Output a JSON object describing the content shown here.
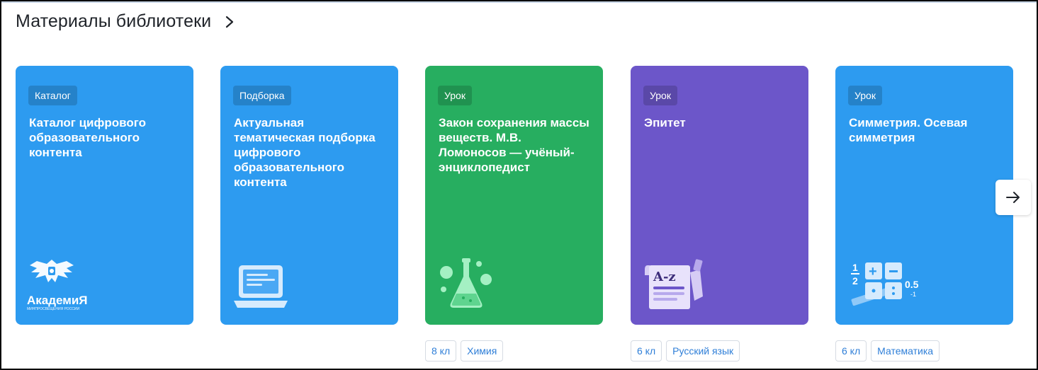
{
  "section": {
    "title": "Материалы библиотеки"
  },
  "cards": [
    {
      "badge": "Каталог",
      "title": "Каталог цифрового образовательного контента",
      "color": "#2d9bf0",
      "logo_text": "АкадемиЯ",
      "logo_sub": "МИНПРОСВЕЩЕНИЯ РОССИИ"
    },
    {
      "badge": "Подборка",
      "title": "Актуальная тематическая подборка цифрового образовательного контента",
      "color": "#2d9bf0"
    },
    {
      "badge": "Урок",
      "title": "Закон сохранения массы веществ. М.В. Ломоносов — учёный-энциклопедист",
      "color": "#27ae60",
      "grade": "8 кл",
      "subject": "Химия"
    },
    {
      "badge": "Урок",
      "title": "Эпитет",
      "color": "#6c56c9",
      "grade": "6 кл",
      "subject": "Русский язык",
      "illus_text": "A-z"
    },
    {
      "badge": "Урок",
      "title": "Симметрия. Осевая симметрия",
      "color": "#2d9bf0",
      "grade": "6 кл",
      "subject": "Математика",
      "illus_fraction_num": "1",
      "illus_fraction_den": "2",
      "illus_decimal": "0.5",
      "illus_neg": "-1"
    }
  ],
  "icons": {
    "header_chevron": "chevron-right-icon",
    "next": "arrow-right-icon"
  }
}
